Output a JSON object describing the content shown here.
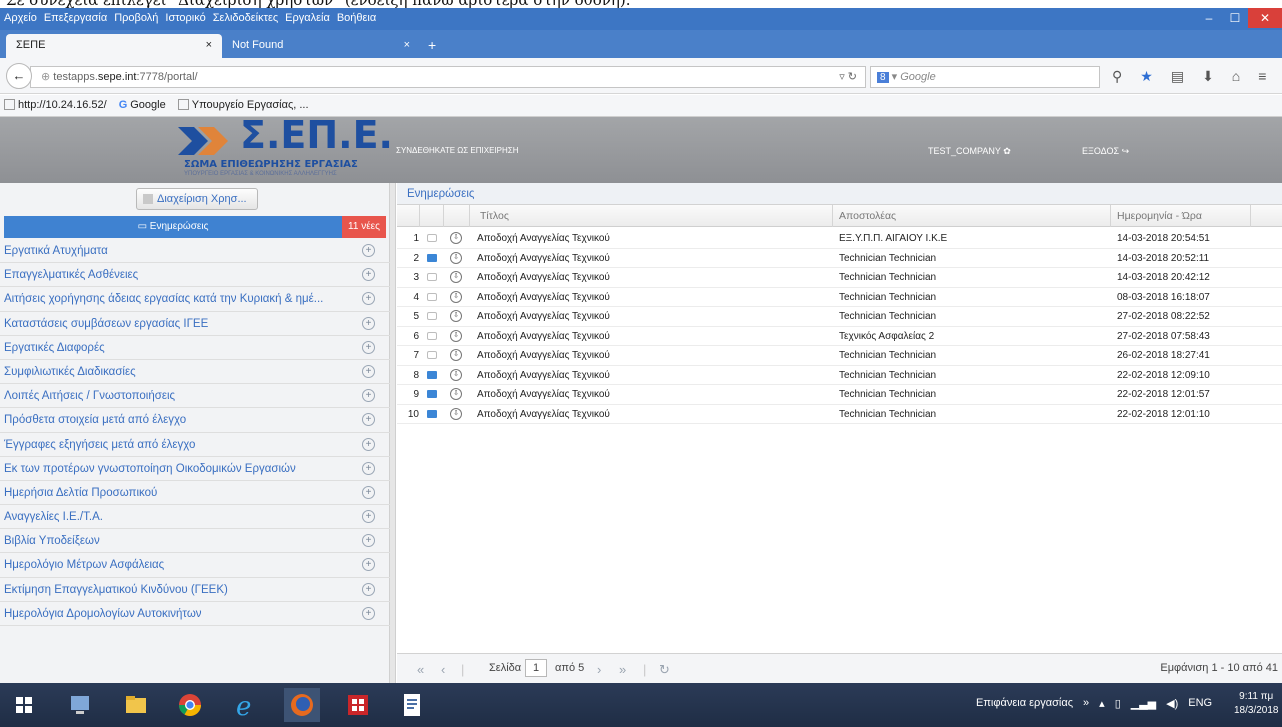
{
  "caption": "Σε συνέχεια επιλέγει \"Διαχείριση χρηστών\" (ένδειξη πάνω αριστερά στην οθόνη).",
  "menubar": [
    "Αρχείο",
    "Επεξεργασία",
    "Προβολή",
    "Ιστορικό",
    "Σελιδοδείκτες",
    "Εργαλεία",
    "Βοήθεια"
  ],
  "window_controls": {
    "minimize": "–",
    "maximize": "☐",
    "close": "✕"
  },
  "tabs": [
    {
      "label": "ΣΕΠΕ",
      "close": "×"
    },
    {
      "label": "Not Found",
      "close": "×"
    }
  ],
  "new_tab": "+",
  "nav": {
    "url_prefix": "testapps.",
    "url_domain": "sepe.int",
    "url_rest": ":7778/portal/",
    "search_placeholder": "Google"
  },
  "bookmarks": [
    {
      "label": "http://10.24.16.52/",
      "icon": "page-icon"
    },
    {
      "label": "Google",
      "icon": "google-icon"
    },
    {
      "label": "Υπουργείο Εργασίας, ...",
      "icon": "page-icon"
    }
  ],
  "header": {
    "logo_title": "Σ.ΕΠ.Ε.",
    "logo_subtitle": "ΣΩΜΑ ΕΠΙΘΕΩΡΗΣΗΣ ΕΡΓΑΣΙΑΣ",
    "logo_subtitle2": "ΥΠΟΥΡΓΕΙΟ ΕΡΓΑΣΙΑΣ & ΚΟΙΝΩΝΙΚΗΣ ΑΛΛΗΛΕΓΓΥΗΣ",
    "logged_as": "ΣΥΝΔΕΘΗΚΑΤΕ ΩΣ ΕΠΙΧΕΙΡΗΣΗ",
    "company": "TEST_COMPANY",
    "logout": "ΕΞΟΔΟΣ"
  },
  "sidebar": {
    "users_button": "Διαχείριση Χρησ...",
    "notifications_label": "Ενημερώσεις",
    "notifications_count": "11 νέες",
    "items": [
      "Εργατικά Ατυχήματα",
      "Επαγγελματικές Ασθένειες",
      "Αιτήσεις χορήγησης άδειας εργασίας κατά την Κυριακή & ημέ...",
      "Καταστάσεις συμβάσεων εργασίας ΙΓΕΕ",
      "Εργατικές Διαφορές",
      "Συμφιλιωτικές Διαδικασίες",
      "Λοιπές Αιτήσεις / Γνωστοποιήσεις",
      "Πρόσθετα στοιχεία μετά από έλεγχο",
      "Έγγραφες εξηγήσεις μετά από έλεγχο",
      "Εκ των προτέρων γνωστοποίηση Οικοδομικών Εργασιών",
      "Ημερήσια Δελτία Προσωπικού",
      "Αναγγελίες Ι.Ε./Τ.Α.",
      "Βιβλία Υποδείξεων",
      "Ημερολόγιο Μέτρων Ασφάλειας",
      "Εκτίμηση Επαγγελματικού Κινδύνου (ΓΕΕΚ)",
      "Ημερολόγια Δρομολογίων Αυτοκινήτων"
    ]
  },
  "main": {
    "title": "Ενημερώσεις",
    "columns": [
      "Τίτλος",
      "Αποστολέας",
      "Ημερομηνία - Ώρα"
    ],
    "rows": [
      {
        "n": "1",
        "read": true,
        "title": "Αποδοχή Αναγγελίας Τεχνικού",
        "sender": "ΕΞ.Υ.Π.Π. ΑΙΓΑΙΟΥ Ι.Κ.Ε",
        "date": "14-03-2018 20:54:51"
      },
      {
        "n": "2",
        "read": false,
        "title": "Αποδοχή Αναγγελίας Τεχνικού",
        "sender": "Technician Technician",
        "date": "14-03-2018 20:52:11"
      },
      {
        "n": "3",
        "read": true,
        "title": "Αποδοχή Αναγγελίας Τεχνικού",
        "sender": "Technician Technician",
        "date": "14-03-2018 20:42:12"
      },
      {
        "n": "4",
        "read": true,
        "title": "Αποδοχή Αναγγελίας Τεχνικού",
        "sender": "Technician Technician",
        "date": "08-03-2018 16:18:07"
      },
      {
        "n": "5",
        "read": true,
        "title": "Αποδοχή Αναγγελίας Τεχνικού",
        "sender": "Technician Technician",
        "date": "27-02-2018 08:22:52"
      },
      {
        "n": "6",
        "read": true,
        "title": "Αποδοχή Αναγγελίας Τεχνικού",
        "sender": "Τεχνικός Ασφαλείας 2",
        "date": "27-02-2018 07:58:43"
      },
      {
        "n": "7",
        "read": true,
        "title": "Αποδοχή Αναγγελίας Τεχνικού",
        "sender": "Technician Technician",
        "date": "26-02-2018 18:27:41"
      },
      {
        "n": "8",
        "read": false,
        "title": "Αποδοχή Αναγγελίας Τεχνικού",
        "sender": "Technician Technician",
        "date": "22-02-2018 12:09:10"
      },
      {
        "n": "9",
        "read": false,
        "title": "Αποδοχή Αναγγελίας Τεχνικού",
        "sender": "Technician Technician",
        "date": "22-02-2018 12:01:57"
      },
      {
        "n": "10",
        "read": false,
        "title": "Αποδοχή Αναγγελίας Τεχνικού",
        "sender": "Technician Technician",
        "date": "22-02-2018 12:01:10"
      }
    ],
    "pager": {
      "page_label": "Σελίδα",
      "page_value": "1",
      "of_label": "από 5",
      "range": "Εμφάνιση 1 - 10 από 41"
    }
  },
  "taskbar": {
    "desktop_label": "Επιφάνεια εργασίας",
    "lang": "ENG",
    "time": "9:11 πμ",
    "date": "18/3/2018"
  },
  "colors": {
    "accent": "#3f82d1",
    "badge": "#e8554c",
    "logo": "#1e4fa0",
    "link": "#3a6fc1"
  }
}
